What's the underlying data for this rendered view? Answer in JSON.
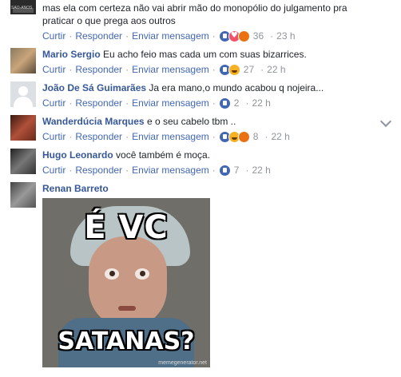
{
  "actions": {
    "reply": "Curtir",
    "respond": "Responder",
    "message": "Enviar mensagem",
    "sep": "·"
  },
  "comments": [
    {
      "author": "",
      "text": "mas ela com certeza não vai abrir mão do monopólio do julgamento pra praticar o que prega aos outros",
      "reactions": [
        "like",
        "love",
        "angry"
      ],
      "count": "36",
      "time": "23 h"
    },
    {
      "author": "Mario Sergio",
      "text": "Eu acho feio mas cada um com suas bizarrices.",
      "reactions": [
        "like",
        "haha"
      ],
      "count": "27",
      "time": "22 h"
    },
    {
      "author": "João De Sá Guimarães",
      "text": "Ja era mano,o mundo acabou q nojeira...",
      "reactions": [
        "like"
      ],
      "count": "2",
      "time": "22 h"
    },
    {
      "author": "Wanderdúcia Marques",
      "text": "e o seu cabelo tbm ..",
      "reactions": [
        "like",
        "haha",
        "angry"
      ],
      "count": "8",
      "time": "22 h"
    },
    {
      "author": "Hugo Leonardo",
      "text": "você também é moça.",
      "reactions": [
        "like"
      ],
      "count": "7",
      "time": "22 h"
    },
    {
      "author": "Renan Barreto",
      "text": ""
    }
  ],
  "meme": {
    "top_text": "É VC",
    "bottom_text": "SATANAS?",
    "watermark": "memegenerator.net"
  },
  "avatar_labels": {
    "first": "SÃO-ANOS"
  },
  "colors": {
    "link": "#4267b2",
    "author": "#365899",
    "meta": "#90949c"
  }
}
